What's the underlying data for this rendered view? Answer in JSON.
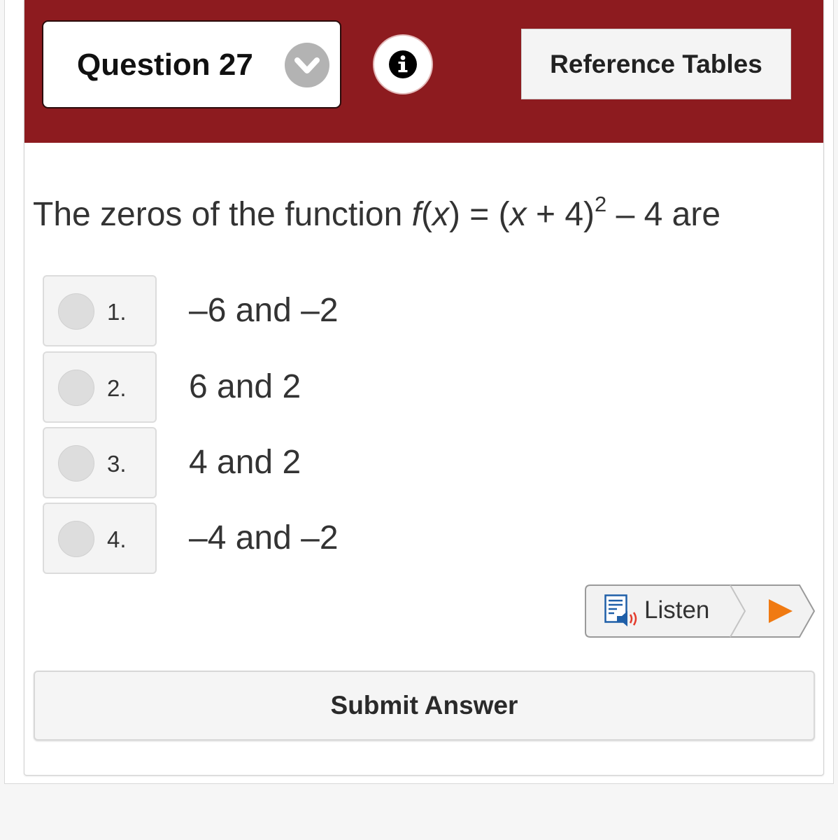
{
  "header": {
    "question_label": "Question 27",
    "dropdown_icon": "chevron-down-icon",
    "info_icon": "info-icon",
    "reference_button_label": "Reference Tables",
    "background_color": "#8d1b1f"
  },
  "question": {
    "prefix": "The zeros of the function ",
    "fn_name": "f",
    "fn_arg_open": "(",
    "fn_var": "x",
    "fn_arg_close": ") = (",
    "expr_var": "x",
    "expr_rest": " + 4)",
    "exponent": "2",
    "suffix": " – 4 are"
  },
  "options": [
    {
      "number": "1.",
      "text": "–6 and –2"
    },
    {
      "number": "2.",
      "text": "6 and 2"
    },
    {
      "number": "3.",
      "text": "4 and 2"
    },
    {
      "number": "4.",
      "text": "–4 and –2"
    }
  ],
  "listen": {
    "label": "Listen",
    "speaker_icon": "speaker-icon",
    "play_icon": "play-icon",
    "play_color": "#f07a12"
  },
  "submit_label": "Submit Answer"
}
